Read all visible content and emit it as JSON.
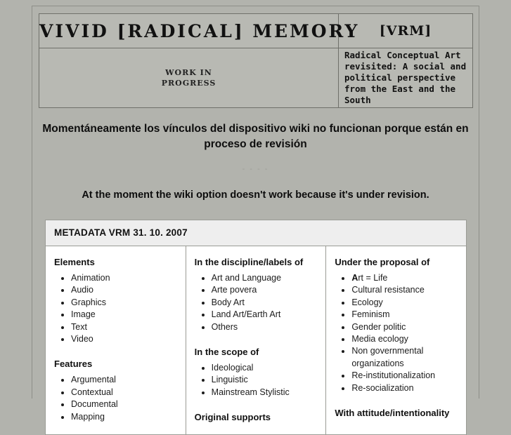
{
  "masthead": {
    "title": "VIVID [RADICAL] MEMORY",
    "acronym": "[VRM]",
    "status_line1": "WORK IN",
    "status_line2": "PROGRESS",
    "subtitle_line1": "Radical Conceptual Art revisited: A social and",
    "subtitle_line2": "political perspective from the East and the South"
  },
  "notices": {
    "spanish": "Momentáneamente los vínculos del dispositivo wiki no funcionan porque están en proceso de revisión",
    "separator": "- - - -",
    "english": "At the moment the wiki option doesn't work because it's under revision."
  },
  "metadata": {
    "header": "METADATA VRM 31. 10. 2007",
    "columns": [
      {
        "sections": [
          {
            "title": "Elements",
            "items": [
              "Animation",
              "Audio",
              "Graphics",
              "Image",
              "Text",
              "Video"
            ]
          },
          {
            "title": "Features",
            "items": [
              "Argumental",
              "Contextual",
              "Documental",
              "Mapping"
            ]
          }
        ]
      },
      {
        "sections": [
          {
            "title": "In the discipline/labels of",
            "items": [
              "Art and Language",
              "Arte povera",
              "Body Art",
              "Land Art/Earth Art",
              "Others"
            ]
          },
          {
            "title": "In the scope of",
            "items": [
              "Ideological",
              "Linguistic",
              "Mainstream Stylistic"
            ]
          },
          {
            "title": "Original supports",
            "items": []
          }
        ]
      },
      {
        "sections": [
          {
            "title": "Under the proposal of",
            "items": [
              "Art = Life",
              "Cultural resistance",
              "Ecology",
              "Feminism",
              "Gender politic",
              "Media ecology",
              "Non governmental organizations",
              "Re-institutionalization",
              "Re-socialization"
            ],
            "first_item_bold_prefix": "A",
            "first_item_rest": "rt = Life"
          },
          {
            "title": "With attitude/intentionality",
            "items": []
          }
        ]
      }
    ]
  },
  "colors": {
    "page_background": "#b2b3ad",
    "masthead_background": "#b8b9b3",
    "table_header_background": "#eeeeee",
    "cell_background": "#ffffff",
    "border": "#9a9b95"
  }
}
